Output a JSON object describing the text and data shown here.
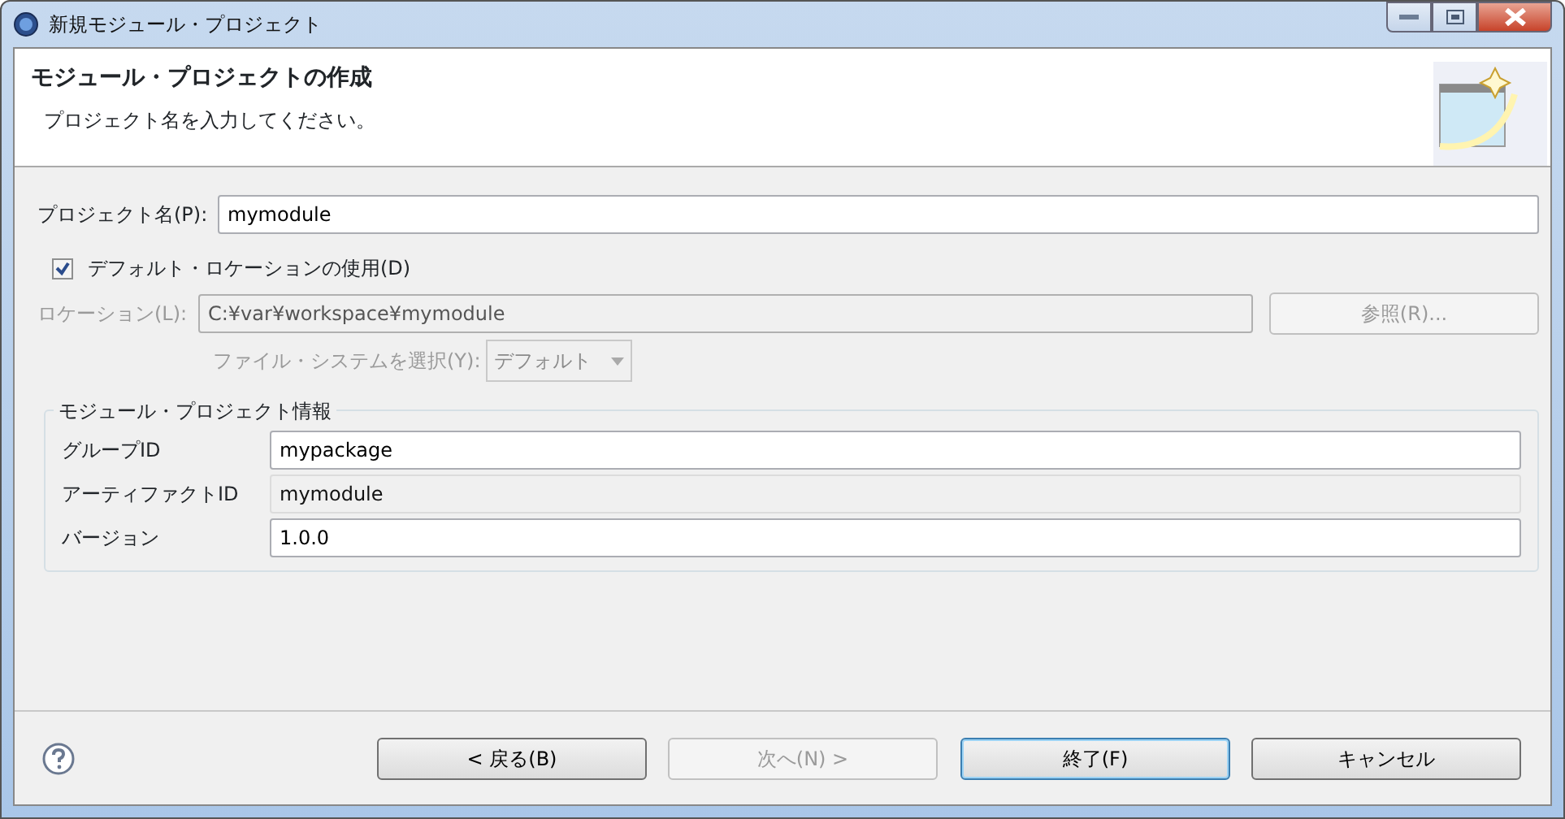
{
  "window": {
    "title": "新規モジュール・プロジェクト"
  },
  "header": {
    "title": "モジュール・プロジェクトの作成",
    "message": "プロジェクト名を入力してください。"
  },
  "project_name": {
    "label": "プロジェクト名(P):",
    "value": "mymodule"
  },
  "default_location": {
    "label": "デフォルト・ロケーションの使用(D)",
    "checked": true
  },
  "location": {
    "label": "ロケーション(L):",
    "value": "C:¥var¥workspace¥mymodule",
    "disabled": true,
    "browse": "参照(R)..."
  },
  "file_system": {
    "label": "ファイル・システムを選択(Y):",
    "value": "デフォルト",
    "disabled": true
  },
  "group": {
    "title": "モジュール・プロジェクト情報",
    "fields": [
      {
        "label": "グループID",
        "value": "mypackage",
        "disabled": false
      },
      {
        "label": "アーティファクトID",
        "value": "mymodule",
        "disabled": true
      },
      {
        "label": "バージョン",
        "value": "1.0.0",
        "disabled": false
      }
    ]
  },
  "buttons": [
    {
      "label": "< 戻る(B)",
      "disabled": false,
      "default": false
    },
    {
      "label": "次へ(N) >",
      "disabled": true,
      "default": false
    },
    {
      "label": "終了(F)",
      "disabled": false,
      "default": true
    },
    {
      "label": "キャンセル",
      "disabled": false,
      "default": false
    }
  ]
}
